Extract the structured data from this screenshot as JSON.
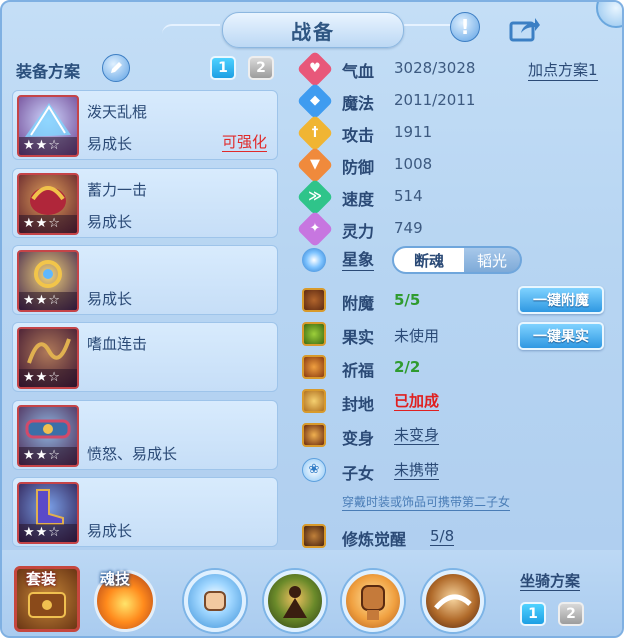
{
  "title": "战备",
  "header": {
    "help_icon": "exclamation-icon",
    "share_icon": "share-icon"
  },
  "plan": {
    "label": "装备方案",
    "tabs": [
      "1",
      "2"
    ],
    "active_tab": "1"
  },
  "equipment": [
    {
      "name": "泼天乱棍",
      "attributes": "易成长",
      "status": "可强化",
      "stars": "★★☆"
    },
    {
      "name": "蓄力一击",
      "attributes": "易成长",
      "status": "",
      "stars": "★★☆"
    },
    {
      "name": "",
      "attributes": "易成长",
      "status": "",
      "stars": "★★☆"
    },
    {
      "name": "嗜血连击",
      "attributes": "",
      "status": "",
      "stars": "★★☆"
    },
    {
      "name": "",
      "attributes": "愤怒、易成长",
      "status": "",
      "stars": "★★☆"
    },
    {
      "name": "",
      "attributes": "易成长",
      "status": "",
      "stars": "★★☆"
    }
  ],
  "stats": {
    "add_point_plan": "加点方案1",
    "items": [
      {
        "label": "气血",
        "value": "3028/3028",
        "color": "#e8587a",
        "icon": "heart-icon"
      },
      {
        "label": "魔法",
        "value": "2011/2011",
        "color": "#3f9cf0",
        "icon": "mana-icon"
      },
      {
        "label": "攻击",
        "value": "1911",
        "color": "#f0b533",
        "icon": "sword-icon"
      },
      {
        "label": "防御",
        "value": "1008",
        "color": "#f08a3c",
        "icon": "shield-icon"
      },
      {
        "label": "速度",
        "value": "514",
        "color": "#2fc48a",
        "icon": "speed-icon"
      },
      {
        "label": "灵力",
        "value": "749",
        "color": "#c776e0",
        "icon": "spirit-icon"
      }
    ]
  },
  "star_sign": {
    "label": "星象",
    "options": [
      "断魂",
      "韬光"
    ],
    "selected": "断魂"
  },
  "features": [
    {
      "label": "附魔",
      "value": "5/5",
      "style": "green"
    },
    {
      "label": "果实",
      "value": "未使用",
      "style": "plain"
    },
    {
      "label": "祈福",
      "value": "2/2",
      "style": "green"
    },
    {
      "label": "封地",
      "value": "已加成",
      "style": "red"
    },
    {
      "label": "变身",
      "value": "未变身",
      "style": "under"
    },
    {
      "label": "子女",
      "value": "未携带",
      "style": "under"
    }
  ],
  "buttons": {
    "enchant_all": "一键附魔",
    "fruit_all": "一键果实"
  },
  "child_hint": "穿戴时装或饰品可携带第二子女",
  "cultivation": {
    "label": "修炼觉醒",
    "value": "5/8"
  },
  "bottom": {
    "suit_label": "套装",
    "soul_label": "魂技",
    "mount_label": "坐骑方案",
    "mount_tabs": [
      "1",
      "2"
    ]
  }
}
